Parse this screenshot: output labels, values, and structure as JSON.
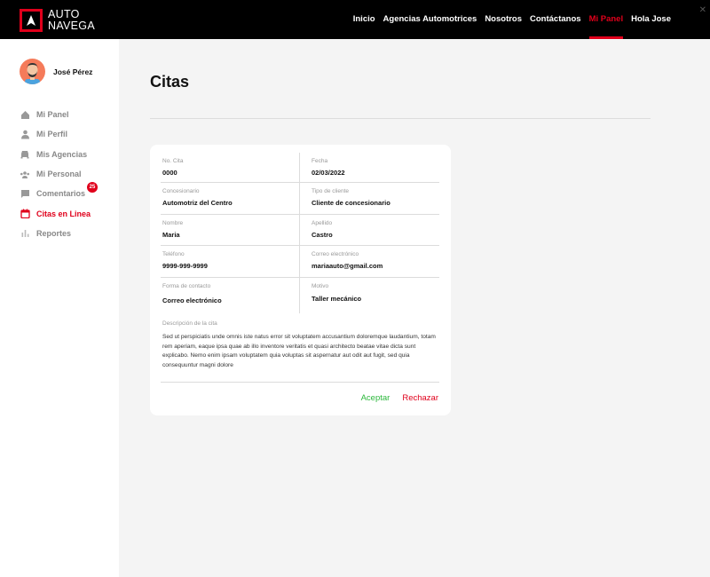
{
  "brand": {
    "line1": "AUTO",
    "line2": "NAVEGA"
  },
  "nav": {
    "items": [
      {
        "label": "Inicio",
        "active": false
      },
      {
        "label": "Agencias Automotrices",
        "active": false
      },
      {
        "label": "Nosotros",
        "active": false
      },
      {
        "label": "Contáctanos",
        "active": false
      },
      {
        "label": "Mi Panel",
        "active": true
      },
      {
        "label": "Hola Jose",
        "active": false
      }
    ],
    "close_glyph": "✕"
  },
  "sidebar": {
    "user_name": "José Pérez",
    "items": [
      {
        "label": "Mi Panel",
        "icon": "home-icon"
      },
      {
        "label": "Mi Perfil",
        "icon": "user-icon"
      },
      {
        "label": "Mis Agencias",
        "icon": "car-icon"
      },
      {
        "label": "Mi Personal",
        "icon": "people-icon"
      },
      {
        "label": "Comentarios",
        "icon": "comment-icon",
        "badge": "25"
      },
      {
        "label": "Citas en Linea",
        "icon": "calendar-icon",
        "active": true
      },
      {
        "label": "Reportes",
        "icon": "chart-icon"
      }
    ]
  },
  "main": {
    "title": "Citas",
    "card": {
      "fields": {
        "no_cita_label": "No. Cita",
        "no_cita_value": "0000",
        "fecha_label": "Fecha",
        "fecha_value": "02/03/2022",
        "concesionario_label": "Concesionario",
        "concesionario_value": "Automotriz del Centro",
        "tipo_label": "Tipo de cliente",
        "tipo_value": "Cliente de concesionario",
        "nombre_label": "Nombre",
        "nombre_value": "Maria",
        "apellido_label": "Apellido",
        "apellido_value": "Castro",
        "telefono_label": "Teléfono",
        "telefono_value": "9999-999-9999",
        "correo_label": "Correo electrónico",
        "correo_value": "mariaauto@gmail.com",
        "forma_label": "Forma de contacto",
        "forma_value": "Correo electrónico",
        "motivo_label": "Motivo",
        "motivo_value": "Taller mecánico"
      },
      "description_label": "Descripción de la cita",
      "description_text": "Sed ut perspiciatis unde omnis iste natus error sit voluptatem accusantium doloremque laudantium, totam rem aperiam, eaque ipsa quae ab illo inventore veritatis et quasi architecto beatae vitae dicta sunt explicabo. Nemo enim ipsam voluptatem quia voluptas sit aspernatur aut odit aut fugit, sed quia consequuntur magni dolore",
      "accept_label": "Aceptar",
      "reject_label": "Rechazar"
    }
  },
  "colors": {
    "accent": "#e0001b",
    "accept": "#2db83d",
    "topbar": "#000000",
    "background": "#f4f4f4"
  }
}
